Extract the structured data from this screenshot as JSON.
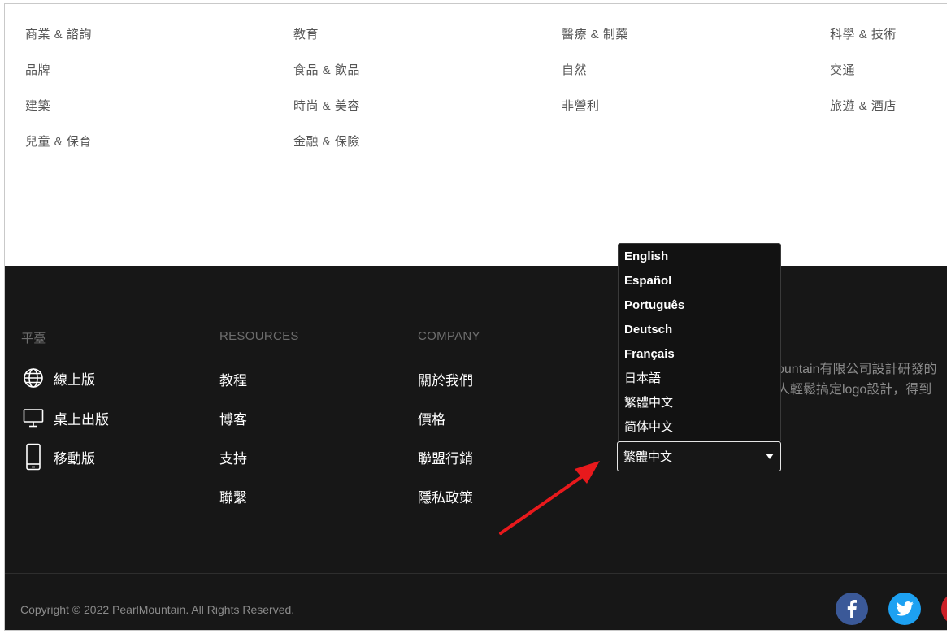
{
  "categories": {
    "col1": [
      "商業 & 諮詢",
      "品牌",
      "建築",
      "兒童 & 保育"
    ],
    "col2": [
      "教育",
      "食品 & 飲品",
      "時尚 & 美容",
      "金融 & 保險"
    ],
    "col3": [
      "醫療 & 制藥",
      "自然",
      "非營利"
    ],
    "col4": [
      "科學 & 技術",
      "交通",
      "旅遊 & 酒店"
    ]
  },
  "footer": {
    "platform": {
      "heading": "平臺",
      "items": [
        {
          "label": "線上版",
          "icon": "globe-icon"
        },
        {
          "label": "桌上出版",
          "icon": "monitor-icon"
        },
        {
          "label": "移動版",
          "icon": "mobile-phone-icon"
        }
      ]
    },
    "resources": {
      "heading": "RESOURCES",
      "items": [
        "教程",
        "博客",
        "支持",
        "聯繫"
      ]
    },
    "company": {
      "heading": "COMPANY",
      "items": [
        "關於我們",
        "價格",
        "聯盟行銷",
        "隱私政策"
      ]
    },
    "about": {
      "line1": "ountain有限公司設計研發的",
      "line2": "人輕鬆搞定logo設計，得到"
    },
    "language": {
      "selected": "繁體中文",
      "options": [
        "English",
        "Español",
        "Português",
        "Deutsch",
        "Français",
        "日本語",
        "繁體中文",
        "简体中文"
      ]
    },
    "copyright": "Copyright © 2022 PearlMountain. All Rights Reserved.",
    "social": [
      {
        "name": "facebook-icon",
        "color": "#3b5998"
      },
      {
        "name": "twitter-icon",
        "color": "#1da1f2"
      },
      {
        "name": "pinterest-icon",
        "color": "#cb2027"
      }
    ]
  },
  "colors": {
    "footer_bg": "#171717",
    "arrow": "#e8191c"
  }
}
